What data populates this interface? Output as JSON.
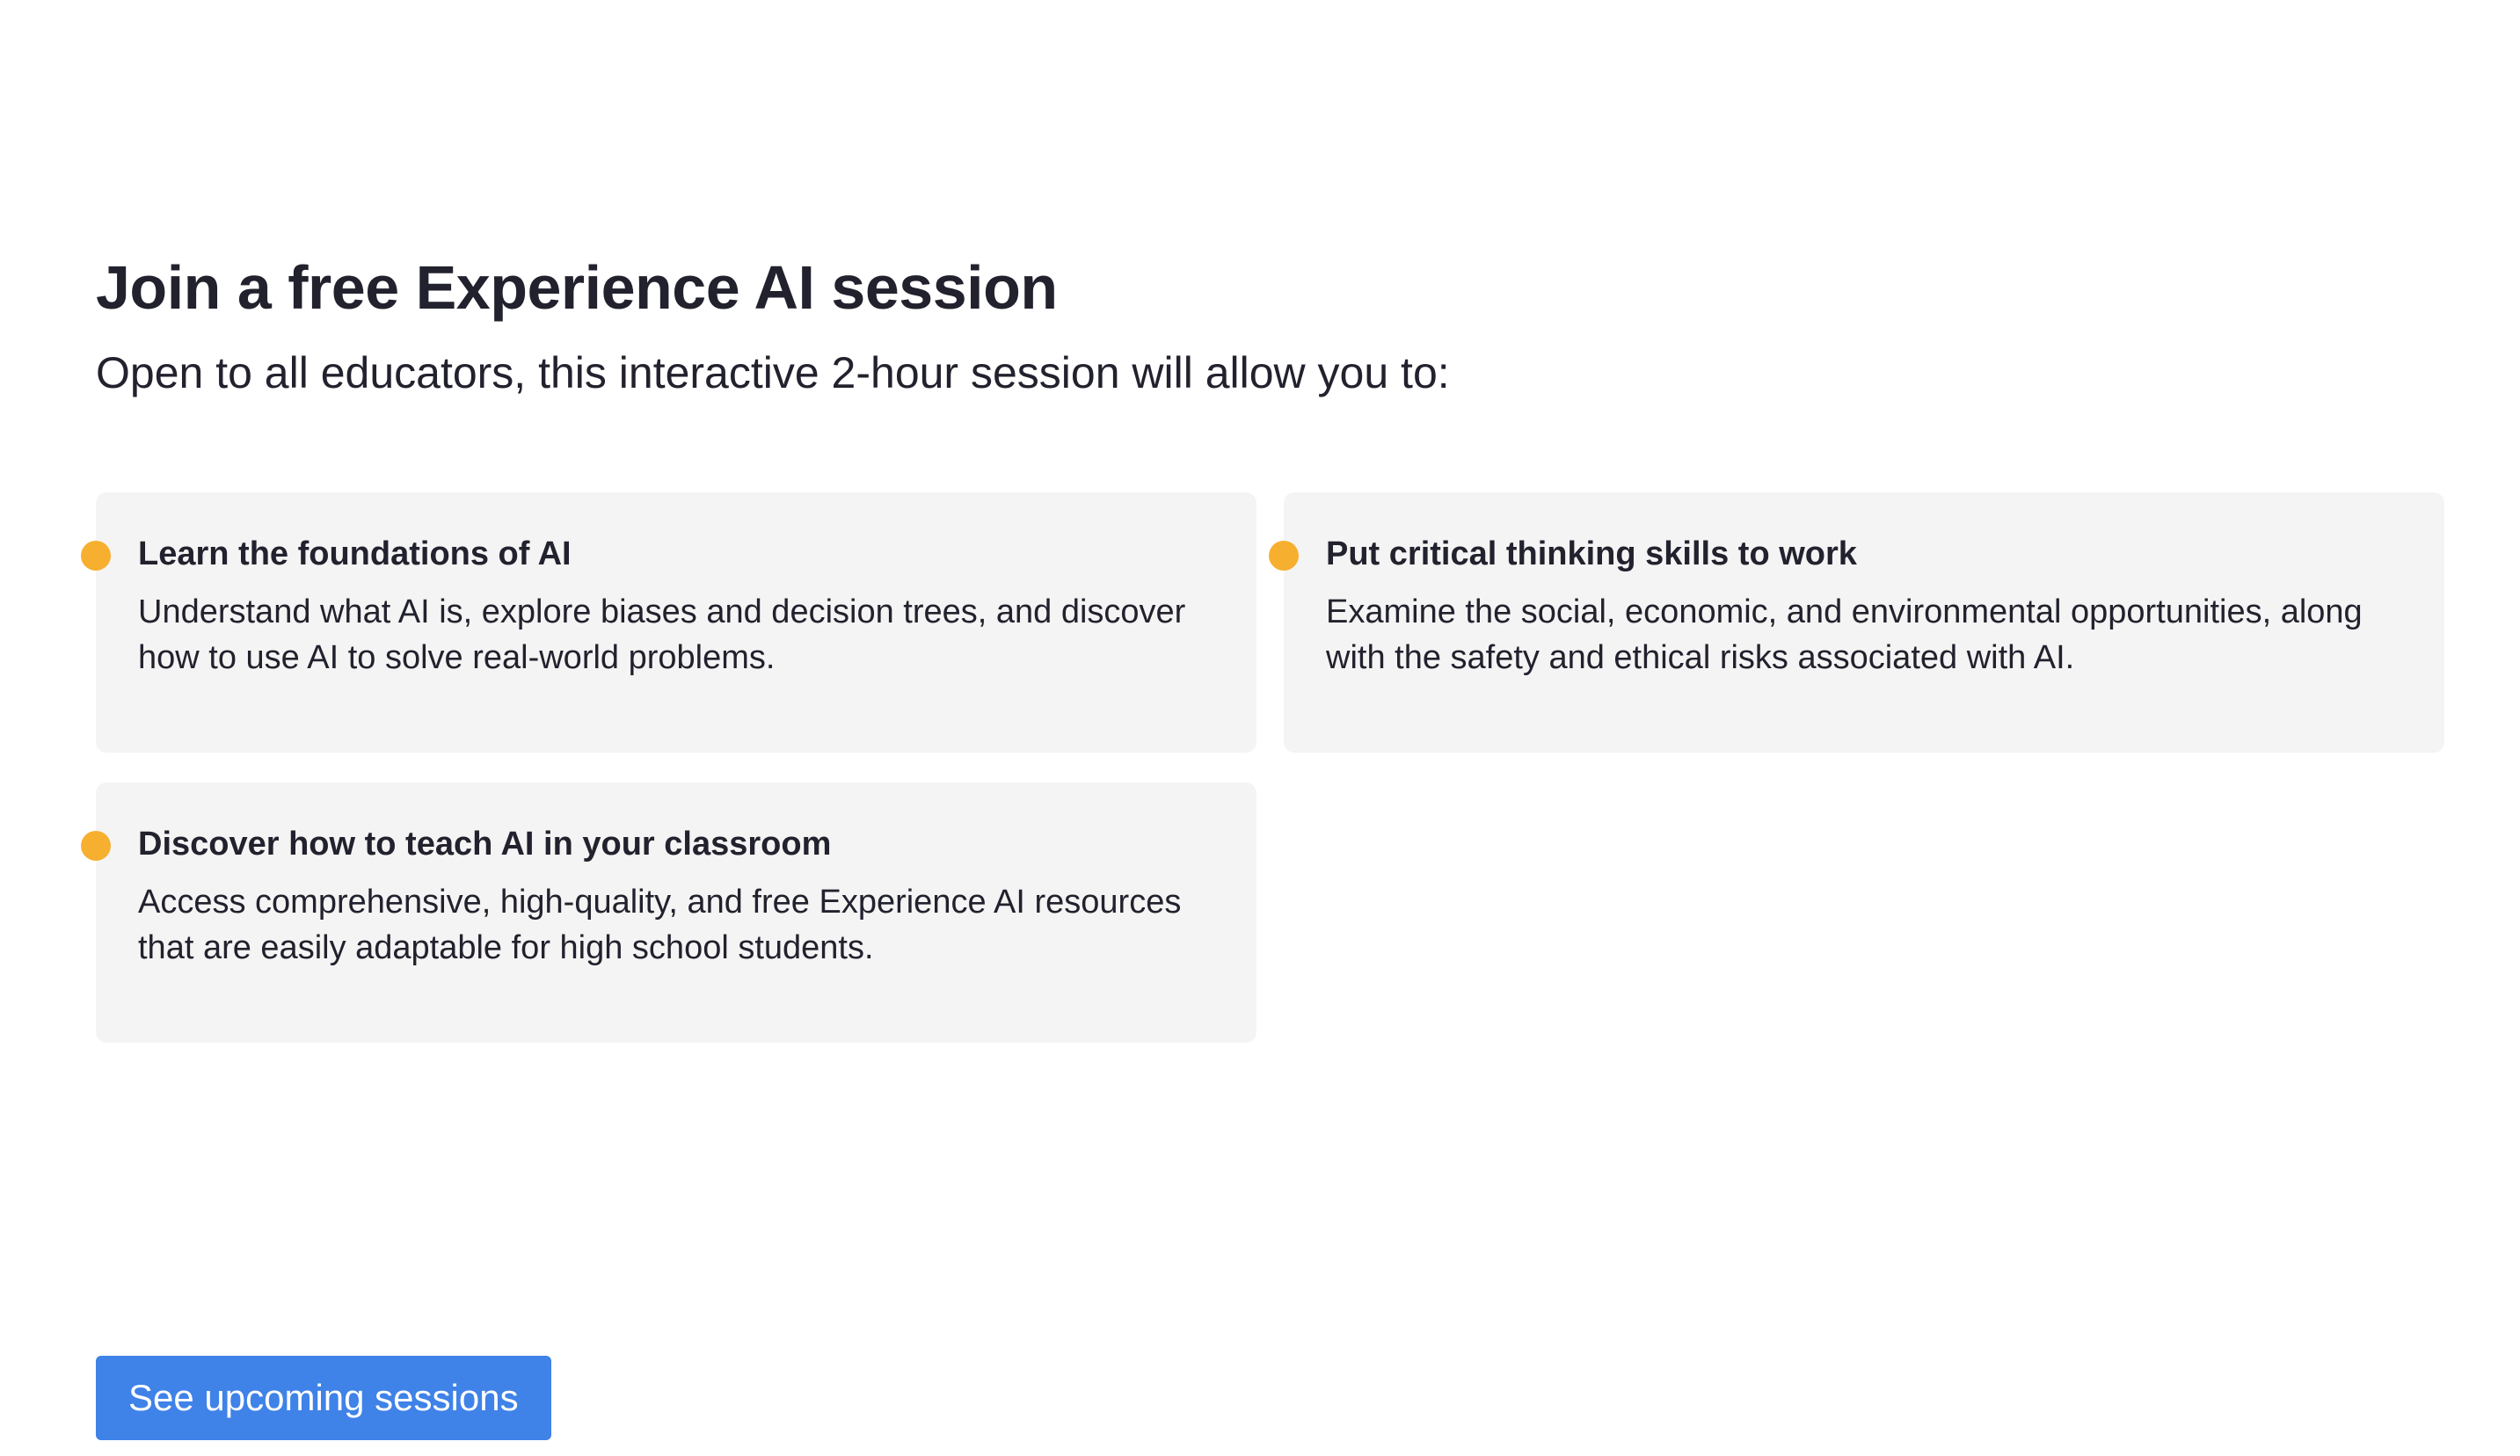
{
  "section": {
    "title": "Join a free Experience AI session",
    "subtitle": "Open to all educators, this interactive 2-hour session will allow you to:",
    "bullet_color": "#f7af2f",
    "cards": [
      {
        "title": "Learn the foundations of AI",
        "body": "Understand what AI is, explore biases and decision trees, and discover how to use AI to solve real-world problems."
      },
      {
        "title": "Put critical thinking skills to work",
        "body": "Examine the social, economic, and environmental opportunities, along with the safety and ethical risks associated with AI."
      },
      {
        "title": "Discover how to teach AI in your classroom",
        "body": "Access comprehensive, high-quality, and free Experience AI resources that are easily adaptable for high school students."
      }
    ],
    "cta": {
      "label": "See upcoming sessions",
      "color": "#3f82e8"
    }
  }
}
